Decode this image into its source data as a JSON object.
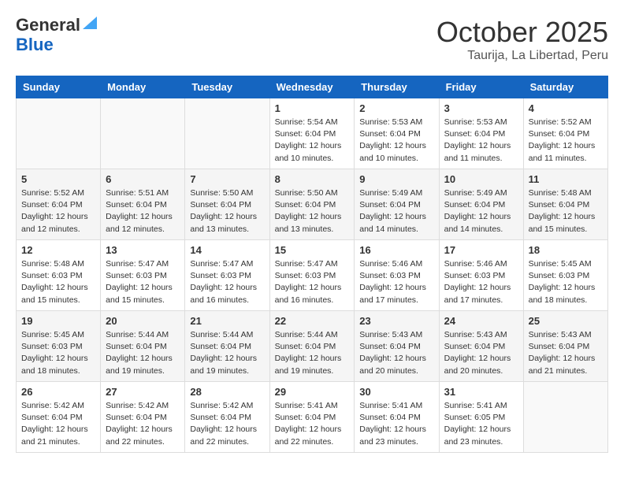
{
  "header": {
    "logo_line1": "General",
    "logo_line2": "Blue",
    "month_title": "October 2025",
    "location": "Taurija, La Libertad, Peru"
  },
  "weekdays": [
    "Sunday",
    "Monday",
    "Tuesday",
    "Wednesday",
    "Thursday",
    "Friday",
    "Saturday"
  ],
  "weeks": [
    [
      {
        "day": "",
        "info": ""
      },
      {
        "day": "",
        "info": ""
      },
      {
        "day": "",
        "info": ""
      },
      {
        "day": "1",
        "info": "Sunrise: 5:54 AM\nSunset: 6:04 PM\nDaylight: 12 hours\nand 10 minutes."
      },
      {
        "day": "2",
        "info": "Sunrise: 5:53 AM\nSunset: 6:04 PM\nDaylight: 12 hours\nand 10 minutes."
      },
      {
        "day": "3",
        "info": "Sunrise: 5:53 AM\nSunset: 6:04 PM\nDaylight: 12 hours\nand 11 minutes."
      },
      {
        "day": "4",
        "info": "Sunrise: 5:52 AM\nSunset: 6:04 PM\nDaylight: 12 hours\nand 11 minutes."
      }
    ],
    [
      {
        "day": "5",
        "info": "Sunrise: 5:52 AM\nSunset: 6:04 PM\nDaylight: 12 hours\nand 12 minutes."
      },
      {
        "day": "6",
        "info": "Sunrise: 5:51 AM\nSunset: 6:04 PM\nDaylight: 12 hours\nand 12 minutes."
      },
      {
        "day": "7",
        "info": "Sunrise: 5:50 AM\nSunset: 6:04 PM\nDaylight: 12 hours\nand 13 minutes."
      },
      {
        "day": "8",
        "info": "Sunrise: 5:50 AM\nSunset: 6:04 PM\nDaylight: 12 hours\nand 13 minutes."
      },
      {
        "day": "9",
        "info": "Sunrise: 5:49 AM\nSunset: 6:04 PM\nDaylight: 12 hours\nand 14 minutes."
      },
      {
        "day": "10",
        "info": "Sunrise: 5:49 AM\nSunset: 6:04 PM\nDaylight: 12 hours\nand 14 minutes."
      },
      {
        "day": "11",
        "info": "Sunrise: 5:48 AM\nSunset: 6:04 PM\nDaylight: 12 hours\nand 15 minutes."
      }
    ],
    [
      {
        "day": "12",
        "info": "Sunrise: 5:48 AM\nSunset: 6:03 PM\nDaylight: 12 hours\nand 15 minutes."
      },
      {
        "day": "13",
        "info": "Sunrise: 5:47 AM\nSunset: 6:03 PM\nDaylight: 12 hours\nand 15 minutes."
      },
      {
        "day": "14",
        "info": "Sunrise: 5:47 AM\nSunset: 6:03 PM\nDaylight: 12 hours\nand 16 minutes."
      },
      {
        "day": "15",
        "info": "Sunrise: 5:47 AM\nSunset: 6:03 PM\nDaylight: 12 hours\nand 16 minutes."
      },
      {
        "day": "16",
        "info": "Sunrise: 5:46 AM\nSunset: 6:03 PM\nDaylight: 12 hours\nand 17 minutes."
      },
      {
        "day": "17",
        "info": "Sunrise: 5:46 AM\nSunset: 6:03 PM\nDaylight: 12 hours\nand 17 minutes."
      },
      {
        "day": "18",
        "info": "Sunrise: 5:45 AM\nSunset: 6:03 PM\nDaylight: 12 hours\nand 18 minutes."
      }
    ],
    [
      {
        "day": "19",
        "info": "Sunrise: 5:45 AM\nSunset: 6:03 PM\nDaylight: 12 hours\nand 18 minutes."
      },
      {
        "day": "20",
        "info": "Sunrise: 5:44 AM\nSunset: 6:04 PM\nDaylight: 12 hours\nand 19 minutes."
      },
      {
        "day": "21",
        "info": "Sunrise: 5:44 AM\nSunset: 6:04 PM\nDaylight: 12 hours\nand 19 minutes."
      },
      {
        "day": "22",
        "info": "Sunrise: 5:44 AM\nSunset: 6:04 PM\nDaylight: 12 hours\nand 19 minutes."
      },
      {
        "day": "23",
        "info": "Sunrise: 5:43 AM\nSunset: 6:04 PM\nDaylight: 12 hours\nand 20 minutes."
      },
      {
        "day": "24",
        "info": "Sunrise: 5:43 AM\nSunset: 6:04 PM\nDaylight: 12 hours\nand 20 minutes."
      },
      {
        "day": "25",
        "info": "Sunrise: 5:43 AM\nSunset: 6:04 PM\nDaylight: 12 hours\nand 21 minutes."
      }
    ],
    [
      {
        "day": "26",
        "info": "Sunrise: 5:42 AM\nSunset: 6:04 PM\nDaylight: 12 hours\nand 21 minutes."
      },
      {
        "day": "27",
        "info": "Sunrise: 5:42 AM\nSunset: 6:04 PM\nDaylight: 12 hours\nand 22 minutes."
      },
      {
        "day": "28",
        "info": "Sunrise: 5:42 AM\nSunset: 6:04 PM\nDaylight: 12 hours\nand 22 minutes."
      },
      {
        "day": "29",
        "info": "Sunrise: 5:41 AM\nSunset: 6:04 PM\nDaylight: 12 hours\nand 22 minutes."
      },
      {
        "day": "30",
        "info": "Sunrise: 5:41 AM\nSunset: 6:04 PM\nDaylight: 12 hours\nand 23 minutes."
      },
      {
        "day": "31",
        "info": "Sunrise: 5:41 AM\nSunset: 6:05 PM\nDaylight: 12 hours\nand 23 minutes."
      },
      {
        "day": "",
        "info": ""
      }
    ]
  ]
}
